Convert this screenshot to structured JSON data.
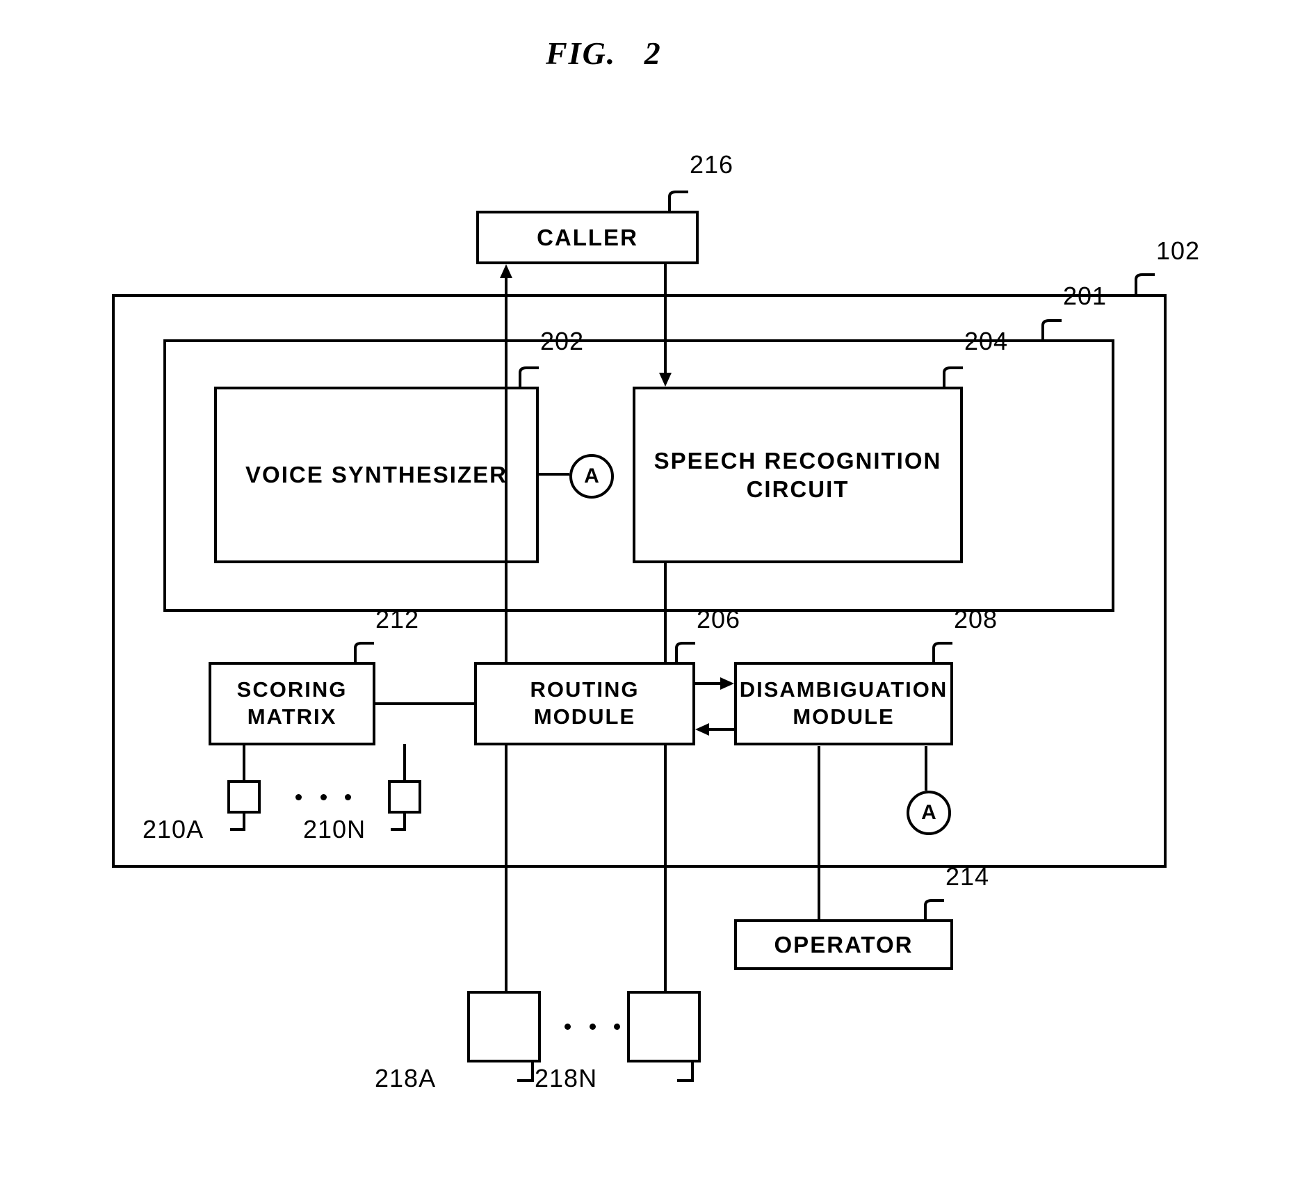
{
  "figure": {
    "title": "FIG.   2",
    "type": "patent-block-diagram"
  },
  "blocks": [
    {
      "id": "216",
      "label": "CALLER",
      "ref": "216"
    },
    {
      "id": "102",
      "label": "",
      "ref": "102"
    },
    {
      "id": "201",
      "label": "",
      "ref": "201"
    },
    {
      "id": "202",
      "label": "VOICE SYNTHESIZER",
      "ref": "202"
    },
    {
      "id": "204",
      "label": "SPEECH RECOGNITION\nCIRCUIT",
      "ref": "204"
    },
    {
      "id": "212",
      "label": "SCORING\nMATRIX",
      "ref": "212"
    },
    {
      "id": "206",
      "label": "ROUTING\nMODULE",
      "ref": "206"
    },
    {
      "id": "208",
      "label": "DISAMBIGUATION\nMODULE",
      "ref": "208"
    },
    {
      "id": "214",
      "label": "OPERATOR",
      "ref": "214"
    },
    {
      "id": "210A",
      "label": "",
      "ref": "210A"
    },
    {
      "id": "210N",
      "label": "",
      "ref": "210N"
    },
    {
      "id": "218A",
      "label": "",
      "ref": "218A"
    },
    {
      "id": "218N",
      "label": "",
      "ref": "218N"
    }
  ],
  "labels": {
    "caller": "CALLER",
    "voice_synthesizer": "VOICE SYNTHESIZER",
    "speech_recognition": "SPEECH RECOGNITION\nCIRCUIT",
    "scoring_matrix": "SCORING\nMATRIX",
    "routing_module": "ROUTING\nMODULE",
    "disambiguation_module": "DISAMBIGUATION\nMODULE",
    "operator": "OPERATOR"
  },
  "refs": {
    "r216": "216",
    "r102": "102",
    "r201": "201",
    "r202": "202",
    "r204": "204",
    "r212": "212",
    "r206": "206",
    "r208": "208",
    "r214": "214",
    "r210a": "210A",
    "r210n": "210N",
    "r218a": "218A",
    "r218n": "218N"
  },
  "connectors": {
    "circle_a_1": "A",
    "circle_a_2": "A"
  },
  "colors": {
    "ink": "#000000",
    "paper": "#ffffff"
  }
}
